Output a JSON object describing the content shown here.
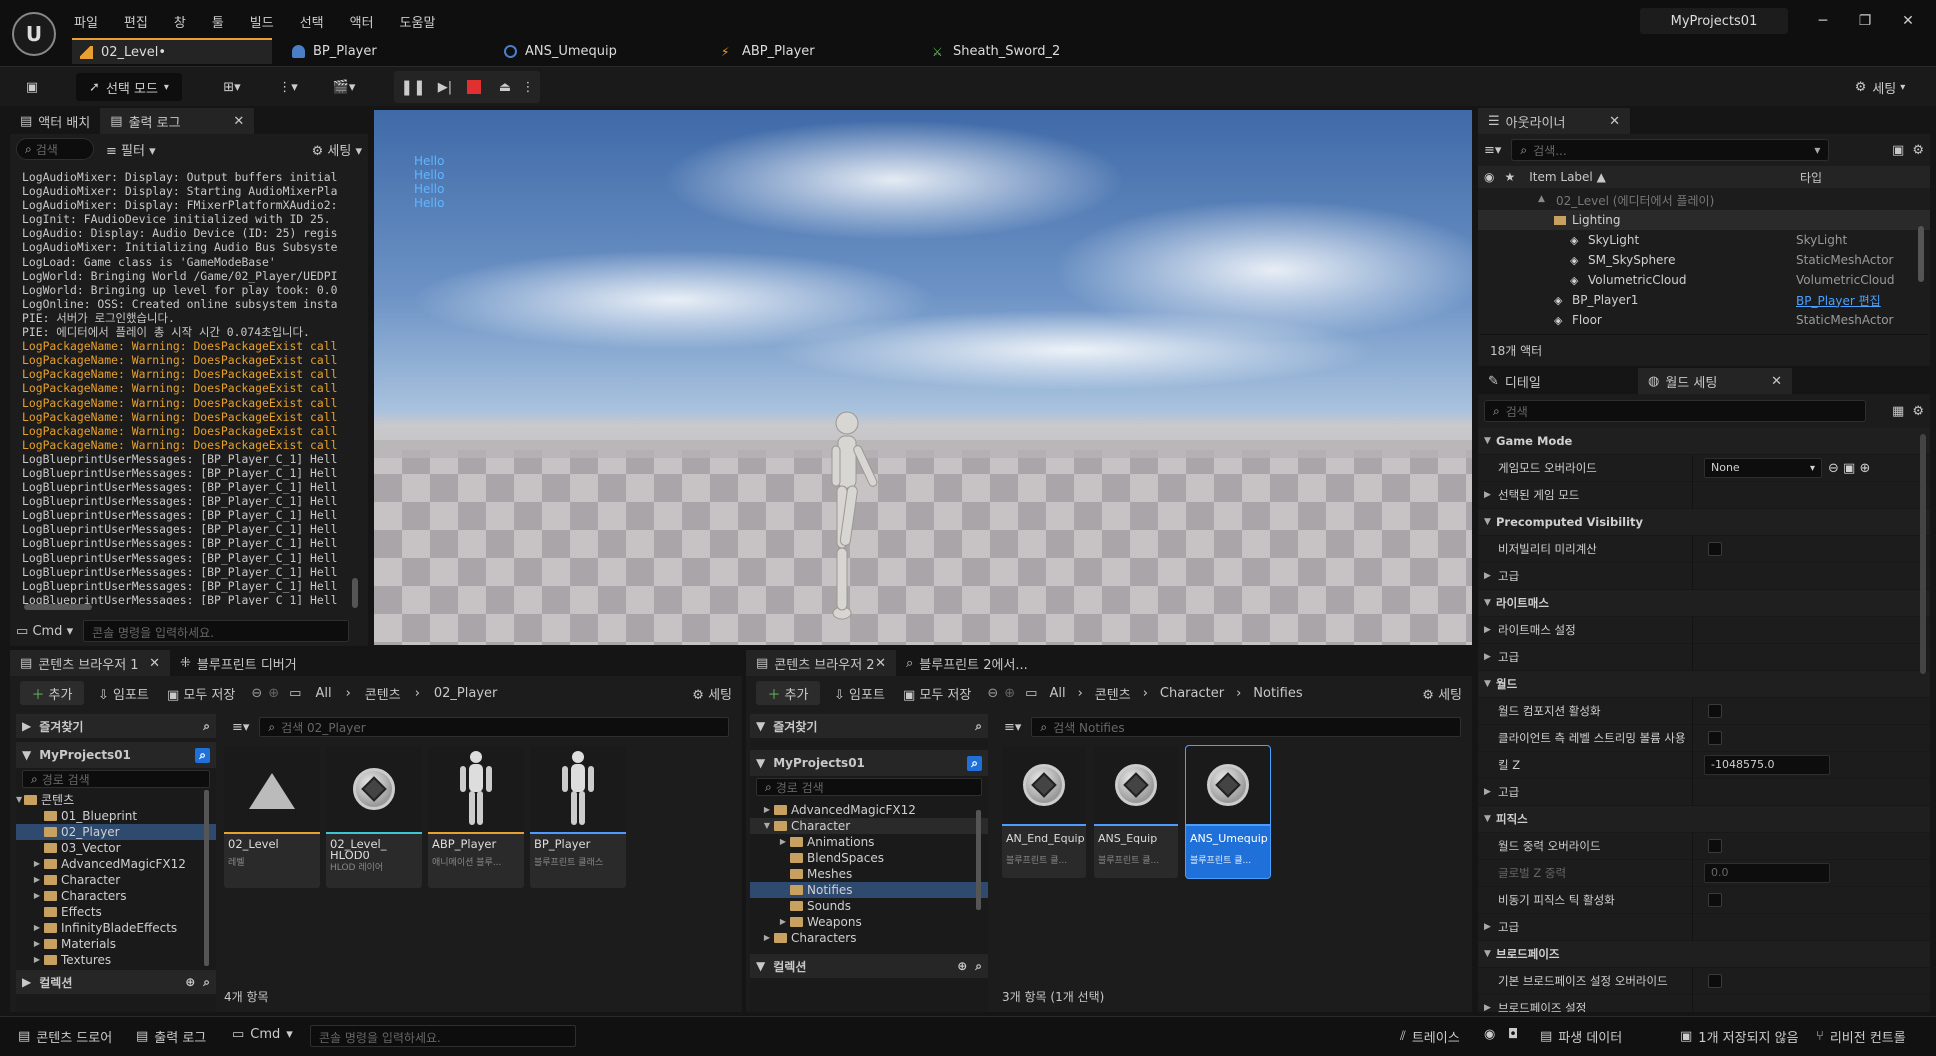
{
  "menu": [
    "파일",
    "편집",
    "창",
    "툴",
    "빌드",
    "선택",
    "액터",
    "도움말"
  ],
  "editor_tabs": [
    {
      "label": "02_Level•"
    },
    {
      "label": "BP_Player"
    },
    {
      "label": "ANS_Umequip"
    },
    {
      "label": "ABP_Player"
    },
    {
      "label": "Sheath_Sword_2"
    }
  ],
  "project_name": "MyProjects01",
  "toolbar": {
    "select_mode": "선택 모드",
    "settings": "세팅"
  },
  "left_panel": {
    "tabs": [
      "액터 배치",
      "출력 로그"
    ],
    "search_placeholder": "검색",
    "filter": "필터",
    "settings": "세팅",
    "log_lines": [
      {
        "t": "LogAudioMixer: Display: Output buffers initial",
        "w": false
      },
      {
        "t": "LogAudioMixer: Display: Starting AudioMixerPla",
        "w": false
      },
      {
        "t": "LogAudioMixer: Display: FMixerPlatformXAudio2:",
        "w": false
      },
      {
        "t": "LogInit: FAudioDevice initialized with ID 25.",
        "w": false
      },
      {
        "t": "LogAudio: Display: Audio Device (ID: 25) regis",
        "w": false
      },
      {
        "t": "LogAudioMixer: Initializing Audio Bus Subsyste",
        "w": false
      },
      {
        "t": "LogLoad: Game class is 'GameModeBase'",
        "w": false
      },
      {
        "t": "LogWorld: Bringing World /Game/02_Player/UEDPI",
        "w": false
      },
      {
        "t": "LogWorld: Bringing up level for play took: 0.0",
        "w": false
      },
      {
        "t": "LogOnline: OSS: Created online subsystem insta",
        "w": false
      },
      {
        "t": "PIE: 서버가 로그인했습니다.",
        "w": false
      },
      {
        "t": "PIE: 에디터에서 플레이 총 시작 시간 0.074초입니다.",
        "w": false
      },
      {
        "t": "LogPackageName: Warning: DoesPackageExist call",
        "w": true
      },
      {
        "t": "LogPackageName: Warning: DoesPackageExist call",
        "w": true
      },
      {
        "t": "LogPackageName: Warning: DoesPackageExist call",
        "w": true
      },
      {
        "t": "LogPackageName: Warning: DoesPackageExist call",
        "w": true
      },
      {
        "t": "LogPackageName: Warning: DoesPackageExist call",
        "w": true
      },
      {
        "t": "LogPackageName: Warning: DoesPackageExist call",
        "w": true
      },
      {
        "t": "LogPackageName: Warning: DoesPackageExist call",
        "w": true
      },
      {
        "t": "LogPackageName: Warning: DoesPackageExist call",
        "w": true
      },
      {
        "t": "LogBlueprintUserMessages: [BP_Player_C_1] Hell",
        "w": false
      },
      {
        "t": "LogBlueprintUserMessages: [BP_Player_C_1] Hell",
        "w": false
      },
      {
        "t": "LogBlueprintUserMessages: [BP_Player_C_1] Hell",
        "w": false
      },
      {
        "t": "LogBlueprintUserMessages: [BP_Player_C_1] Hell",
        "w": false
      },
      {
        "t": "LogBlueprintUserMessages: [BP_Player_C_1] Hell",
        "w": false
      },
      {
        "t": "LogBlueprintUserMessages: [BP_Player_C_1] Hell",
        "w": false
      },
      {
        "t": "LogBlueprintUserMessages: [BP_Player_C_1] Hell",
        "w": false
      },
      {
        "t": "LogBlueprintUserMessages: [BP_Player_C_1] Hell",
        "w": false
      },
      {
        "t": "LogBlueprintUserMessages: [BP_Player_C_1] Hell",
        "w": false
      },
      {
        "t": "LogBlueprintUserMessages: [BP_Player_C_1] Hell",
        "w": false
      },
      {
        "t": "LogBlueprintUserMessages: [BP_Player_C_1] Hell",
        "w": false
      }
    ],
    "cmd": "Cmd",
    "console_placeholder": "콘솔 명령을 입력하세요."
  },
  "viewport": {
    "hello_lines": [
      "Hello",
      "Hello",
      "Hello",
      "Hello"
    ]
  },
  "outliner": {
    "tab": "아웃라이너",
    "search_placeholder": "검색...",
    "col_label": "Item Label ▲",
    "col_type": "타입",
    "rows": [
      {
        "label": "02_Level (에디터에서 플레이)",
        "type": "",
        "indent": 60,
        "dim": true
      },
      {
        "label": "Lighting",
        "type": "",
        "indent": 76,
        "folder": true
      },
      {
        "label": "SkyLight",
        "type": "SkyLight",
        "indent": 92
      },
      {
        "label": "SM_SkySphere",
        "type": "StaticMeshActor",
        "indent": 92
      },
      {
        "label": "VolumetricCloud",
        "type": "VolumetricCloud",
        "indent": 92
      },
      {
        "label": "BP_Player1",
        "type": "BP_Player 편집",
        "indent": 76,
        "link": true
      },
      {
        "label": "Floor",
        "type": "StaticMeshActor",
        "indent": 76
      }
    ],
    "count": "18개 액터"
  },
  "details": {
    "tabs": [
      "디테일",
      "월드 세팅"
    ],
    "search_placeholder": "검색",
    "rows": [
      {
        "label": "Game Mode",
        "kind": "section"
      },
      {
        "label": "게임모드 오버라이드",
        "kind": "combo",
        "value": "None"
      },
      {
        "label": "선택된 게임 모드",
        "kind": "sub"
      },
      {
        "label": "Precomputed Visibility",
        "kind": "section"
      },
      {
        "label": "비저빌리티 미리계산",
        "kind": "check"
      },
      {
        "label": "고급",
        "kind": "sub"
      },
      {
        "label": "라이트매스",
        "kind": "section"
      },
      {
        "label": "라이트매스 설정",
        "kind": "sub"
      },
      {
        "label": "고급",
        "kind": "sub"
      },
      {
        "label": "월드",
        "kind": "section"
      },
      {
        "label": "월드 컴포지션 활성화",
        "kind": "check"
      },
      {
        "label": "클라이언트 측 레벨 스트리밍 볼륨 사용",
        "kind": "check"
      },
      {
        "label": "킬 Z",
        "kind": "input",
        "value": "-1048575.0"
      },
      {
        "label": "고급",
        "kind": "sub"
      },
      {
        "label": "피직스",
        "kind": "section"
      },
      {
        "label": "월드 중력 오버라이드",
        "kind": "check"
      },
      {
        "label": "글로벌 Z 중력",
        "kind": "input_dim",
        "value": "0.0"
      },
      {
        "label": "비동기 피직스 틱 활성화",
        "kind": "check"
      },
      {
        "label": "고급",
        "kind": "sub"
      },
      {
        "label": "브로드페이즈",
        "kind": "section"
      },
      {
        "label": "기본 브로드페이즈 설정 오버라이드",
        "kind": "check"
      },
      {
        "label": "브로드페이즈 설정",
        "kind": "sub"
      }
    ]
  },
  "cb1": {
    "tabs": [
      "콘텐츠 브라우저 1",
      "블루프린트 디버거"
    ],
    "add": "추가",
    "import": "임포트",
    "save_all": "모두 저장",
    "settings": "세팅",
    "path": [
      "All",
      "콘텐츠",
      "02_Player"
    ],
    "favorites": "즐겨찾기",
    "project": "MyProjects01",
    "path_search": "경로 검색",
    "asset_search": "검색 02_Player",
    "tree": [
      {
        "label": "콘텐츠",
        "indent": 8,
        "arrow": "▼"
      },
      {
        "label": "01_Blueprint",
        "indent": 28,
        "arrow": ""
      },
      {
        "label": "02_Player",
        "indent": 28,
        "arrow": "",
        "sel": true
      },
      {
        "label": "03_Vector",
        "indent": 28,
        "arrow": ""
      },
      {
        "label": "AdvancedMagicFX12",
        "indent": 28,
        "arrow": "▶"
      },
      {
        "label": "Character",
        "indent": 28,
        "arrow": "▶"
      },
      {
        "label": "Characters",
        "indent": 28,
        "arrow": "▶"
      },
      {
        "label": "Effects",
        "indent": 28,
        "arrow": ""
      },
      {
        "label": "InfinityBladeEffects",
        "indent": 28,
        "arrow": "▶"
      },
      {
        "label": "Materials",
        "indent": 28,
        "arrow": "▶"
      },
      {
        "label": "Textures",
        "indent": 28,
        "arrow": "▶"
      }
    ],
    "collections": "컬렉션",
    "assets": [
      {
        "name": "02_Level",
        "type": "레벨",
        "color": "#e8a033"
      },
      {
        "name": "02_Level_",
        "name2": "HLOD0",
        "type": "HLOD 레이어",
        "color": "#3ec6d0"
      },
      {
        "name": "ABP_Player",
        "type": "애니메이션 블루...",
        "color": "#e8a033"
      },
      {
        "name": "BP_Player",
        "type": "블루프린트 클래스",
        "color": "#4a9cff"
      }
    ],
    "count": "4개 항목"
  },
  "cb2": {
    "tabs": [
      "콘텐츠 브라우저 2",
      "블루프린트 2에서..."
    ],
    "add": "추가",
    "import": "임포트",
    "save_all": "모두 저장",
    "settings": "세팅",
    "path": [
      "All",
      "콘텐츠",
      "Character",
      "Notifies"
    ],
    "favorites": "즐겨찾기",
    "project": "MyProjects01",
    "path_search": "경로 검색",
    "asset_search": "검색 Notifies",
    "tree": [
      {
        "label": "AdvancedMagicFX12",
        "indent": 24,
        "arrow": "▶"
      },
      {
        "label": "Character",
        "indent": 24,
        "arrow": "▼",
        "hl": true
      },
      {
        "label": "Animations",
        "indent": 40,
        "arrow": "▶"
      },
      {
        "label": "BlendSpaces",
        "indent": 40,
        "arrow": ""
      },
      {
        "label": "Meshes",
        "indent": 40,
        "arrow": ""
      },
      {
        "label": "Notifies",
        "indent": 40,
        "arrow": "",
        "sel": true
      },
      {
        "label": "Sounds",
        "indent": 40,
        "arrow": ""
      },
      {
        "label": "Weapons",
        "indent": 40,
        "arrow": "▶"
      },
      {
        "label": "Characters",
        "indent": 24,
        "arrow": "▶"
      }
    ],
    "collections": "컬렉션",
    "assets": [
      {
        "name": "AN_End_Equip",
        "type": "블루프린트 클..."
      },
      {
        "name": "ANS_Equip",
        "type": "블루프린트 클..."
      },
      {
        "name": "ANS_Umequip",
        "type": "블루프린트 클...",
        "sel": true
      }
    ],
    "count": "3개 항목 (1개 선택)"
  },
  "statusbar": {
    "content_drawer": "콘텐츠 드로어",
    "output_log": "출력 로그",
    "cmd": "Cmd",
    "console_placeholder": "콘솔 명령을 입력하세요.",
    "trace": "트레이스",
    "derived_data": "파생 데이터",
    "unsaved": "1개 저장되지 않음",
    "revision_control": "리비전 컨트롤"
  }
}
